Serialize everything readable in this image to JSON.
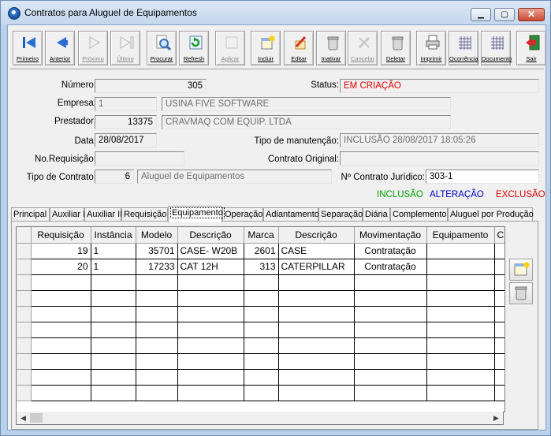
{
  "window": {
    "title": "Contratos para Aluguel de Equipamentos",
    "min_icon": "minimize-icon",
    "max_icon": "maximize-icon",
    "close_icon": "close-icon"
  },
  "toolbar": [
    {
      "label": "Primeiro",
      "icon": "first-icon",
      "enabled": true
    },
    {
      "label": "Anterior",
      "icon": "previous-icon",
      "enabled": true
    },
    {
      "label": "Próximo",
      "icon": "next-icon",
      "enabled": false
    },
    {
      "label": "Último",
      "icon": "last-icon",
      "enabled": false
    },
    {
      "label": "Procurar",
      "icon": "search-icon",
      "enabled": true
    },
    {
      "label": "Refresh",
      "icon": "refresh-icon",
      "enabled": true
    },
    {
      "label": "Aplicar",
      "icon": "apply-icon",
      "enabled": false
    },
    {
      "label": "Incluir",
      "icon": "add-icon",
      "enabled": true
    },
    {
      "label": "Editar",
      "icon": "edit-icon",
      "enabled": true
    },
    {
      "label": "Inativar",
      "icon": "deactivate-icon",
      "enabled": true
    },
    {
      "label": "Cancelar",
      "icon": "cancel-icon",
      "enabled": false
    },
    {
      "label": "Deletar",
      "icon": "delete-icon",
      "enabled": true
    },
    {
      "label": "Imprimir",
      "icon": "print-icon",
      "enabled": true
    },
    {
      "label": "Ocorrência",
      "icon": "occurrence-icon",
      "enabled": true
    },
    {
      "label": "Documento",
      "icon": "document-icon",
      "enabled": true
    },
    {
      "label": "Sair",
      "icon": "exit-icon",
      "enabled": true
    }
  ],
  "form": {
    "numero_label": "Número:",
    "numero": "305",
    "status_label": "Status:",
    "status": "EM CRIAÇÃO",
    "empresa_label": "Empresa:",
    "empresa_cod": "1",
    "empresa_nome": "USINA FIVE SOFTWARE",
    "prestador_label": "Prestador:",
    "prestador_cod": "13375",
    "prestador_nome": "CRAVMAQ COM EQUIP. LTDA",
    "data_label": "Data:",
    "data": "28/08/2017",
    "tipo_manut_label": "Tipo de manutenção:",
    "tipo_manut": "INCLUSÃO 28/08/2017 18:05:26",
    "no_req_label": "No.Requisição:",
    "no_req": "",
    "contrato_orig_label": "Contrato Original:",
    "contrato_orig": "",
    "tipo_contrato_label": "Tipo de Contrato:",
    "tipo_contrato_cod": "6",
    "tipo_contrato_nome": "Aluguel de Equipamentos",
    "contrato_jur_label": "Nº Contrato Jurídico:",
    "contrato_jur": "303-1"
  },
  "legend": {
    "inclusao": "INCLUSÃO",
    "inclusao_color": "#00a000",
    "alteracao": "ALTERAÇÃO",
    "alteracao_color": "#0000c8",
    "exclusao": "EXCLUSÃO",
    "exclusao_color": "#e00000"
  },
  "tabs": [
    "Principal",
    "Auxiliar I",
    "Auxiliar II",
    "Requisição",
    "Equipamento",
    "Operação",
    "Adiantamento",
    "Separação",
    "Diária",
    "Complemento",
    "Aluguel por Produção"
  ],
  "active_tab": "Equipamento",
  "grid": {
    "columns": [
      "Requisição",
      "Instância",
      "Modelo",
      "Descrição",
      "Marca",
      "Descrição",
      "Movimentação",
      "Equipamento",
      "C"
    ],
    "rows": [
      [
        "19",
        "1",
        "35701",
        "CASE- W20B",
        "2601",
        "CASE",
        "Contratação",
        "",
        ""
      ],
      [
        "20",
        "1",
        "17233",
        "CAT 12H",
        "313",
        "CATERPILLAR",
        "Contratação",
        "",
        ""
      ]
    ]
  },
  "side_buttons": [
    {
      "icon": "add-row-icon"
    },
    {
      "icon": "delete-row-icon"
    }
  ]
}
